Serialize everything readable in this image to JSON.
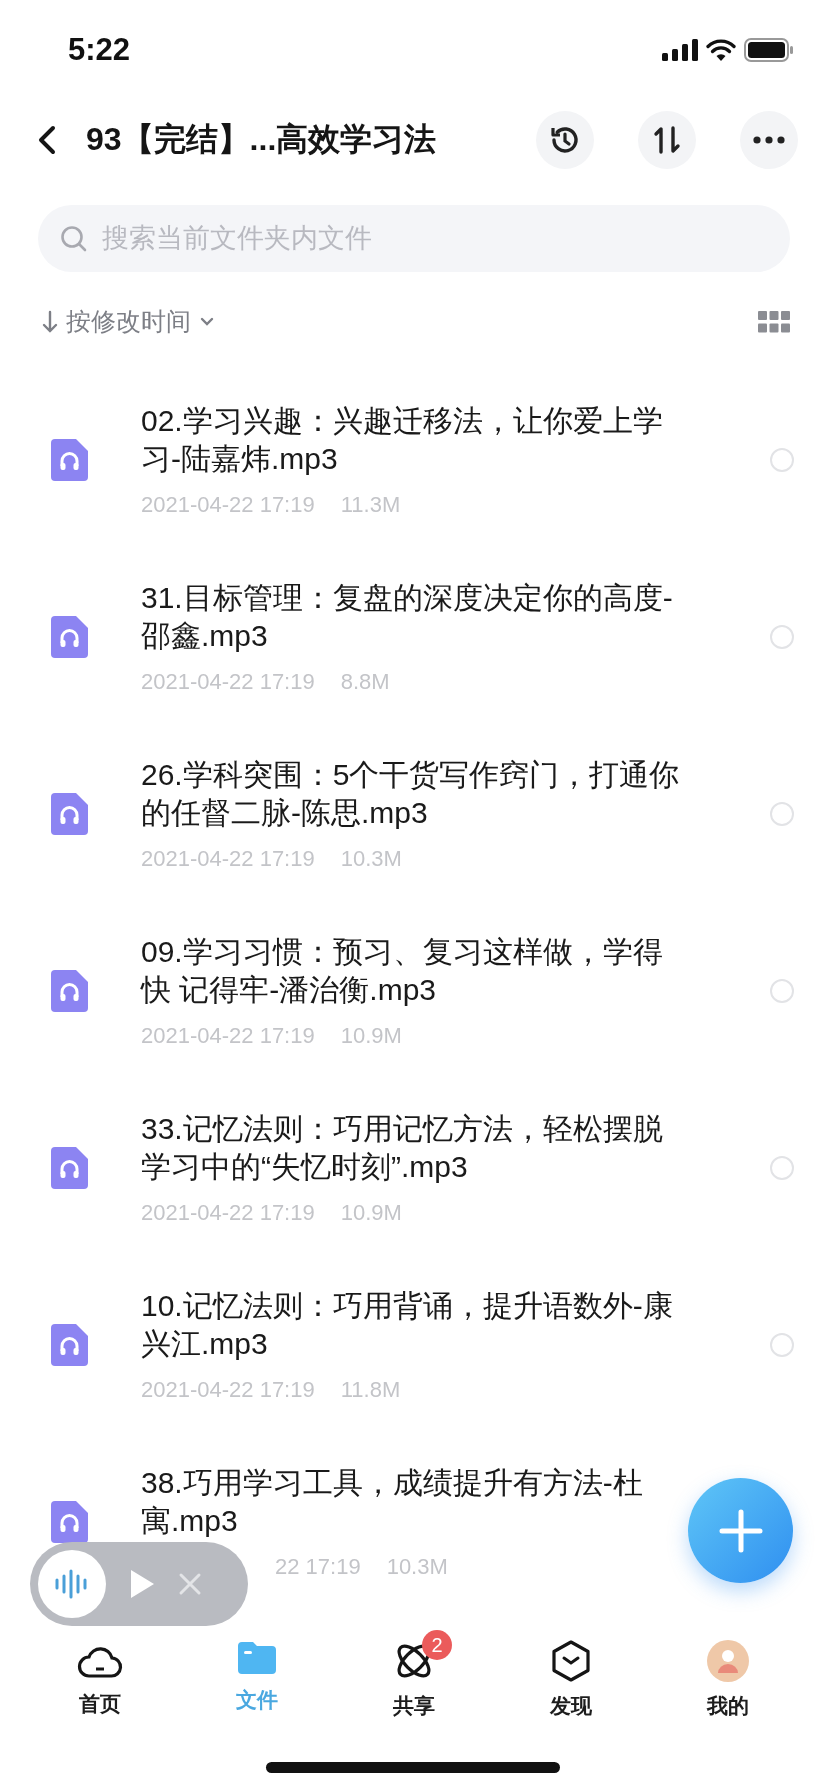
{
  "status_bar": {
    "time": "5:22"
  },
  "header": {
    "title": "93【完结】...高效学习法"
  },
  "search": {
    "placeholder": "搜索当前文件夹内文件"
  },
  "sort": {
    "label": "按修改时间"
  },
  "files": [
    {
      "name": "02.学习兴趣：兴趣迁移法，让你爱上学习-陆嘉炜.mp3",
      "date": "2021-04-22 17:19",
      "size": "11.3M",
      "selected": false
    },
    {
      "name": "31.目标管理：复盘的深度决定你的高度-邵鑫.mp3",
      "date": "2021-04-22 17:19",
      "size": "8.8M",
      "selected": false
    },
    {
      "name": "26.学科突围：5个干货写作窍门，打通你的任督二脉-陈思.mp3",
      "date": "2021-04-22 17:19",
      "size": "10.3M",
      "selected": false
    },
    {
      "name": "09.学习习惯：预习、复习这样做，学得快 记得牢-潘治衡.mp3",
      "date": "2021-04-22 17:19",
      "size": "10.9M",
      "selected": false
    },
    {
      "name": "33.记忆法则：巧用记忆方法，轻松摆脱学习中的“失忆时刻”.mp3",
      "date": "2021-04-22 17:19",
      "size": "10.9M",
      "selected": false
    },
    {
      "name": "10.记忆法则：巧用背诵，提升语数外-康兴江.mp3",
      "date": "2021-04-22 17:19",
      "size": "11.8M",
      "selected": false
    },
    {
      "name": "38.巧用学习工具，成绩提升有方法-杜寓.mp3",
      "date": "22 17:19",
      "size": "10.3M",
      "covered": true
    }
  ],
  "tabs": [
    {
      "label": "首页",
      "kind": "cloud",
      "selected": false
    },
    {
      "label": "文件",
      "kind": "folder",
      "selected": true
    },
    {
      "label": "共享",
      "kind": "orbit",
      "selected": false,
      "badge": "2"
    },
    {
      "label": "发现",
      "kind": "hexagon",
      "selected": false
    },
    {
      "label": "我的",
      "kind": "avatar",
      "selected": false
    }
  ]
}
